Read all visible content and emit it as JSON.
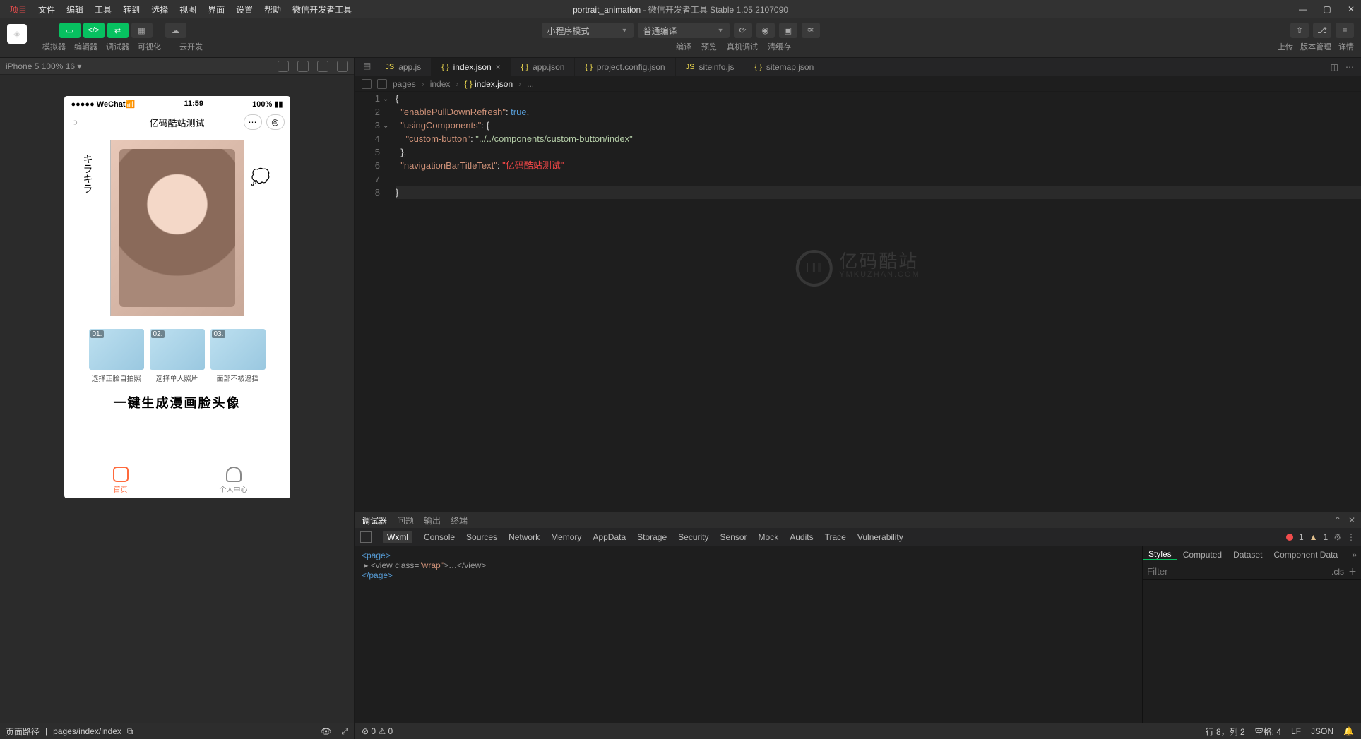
{
  "title": {
    "project": "portrait_animation",
    "sep": " - ",
    "app": "微信开发者工具 Stable 1.05.2107090"
  },
  "menu": [
    "项目",
    "文件",
    "编辑",
    "工具",
    "转到",
    "选择",
    "视图",
    "界面",
    "设置",
    "帮助",
    "微信开发者工具"
  ],
  "toolbar": {
    "left_labels": [
      "模拟器",
      "编辑器",
      "调试器",
      "可视化",
      "",
      "云开发"
    ],
    "mode_dd": "小程序模式",
    "compile_dd": "普通编译",
    "compile_labels": [
      "编译",
      "预览",
      "真机调试",
      "清缓存"
    ],
    "right_labels": [
      "上传",
      "版本管理",
      "详情"
    ]
  },
  "sim": {
    "device": "iPhone 5 100% 16",
    "status_left": "●●●●● WeChat",
    "status_wifi": "📶",
    "status_time": "11:59",
    "status_batt": "100%",
    "nav_title": "亿码酷站测试",
    "thumbs": [
      {
        "num": "01.",
        "cap": "选择正脸自拍照"
      },
      {
        "num": "02.",
        "cap": "选择单人照片"
      },
      {
        "num": "03.",
        "cap": "面部不被遮挡"
      }
    ],
    "slogan": "一键生成漫画脸头像",
    "tabs": [
      {
        "label": "首页",
        "active": true
      },
      {
        "label": "个人中心",
        "active": false
      }
    ]
  },
  "filetabs": [
    {
      "icon": "js",
      "name": "app.js"
    },
    {
      "icon": "json",
      "name": "index.json",
      "active": true
    },
    {
      "icon": "json",
      "name": "app.json"
    },
    {
      "icon": "json",
      "name": "project.config.json"
    },
    {
      "icon": "js",
      "name": "siteinfo.js"
    },
    {
      "icon": "json",
      "name": "sitemap.json"
    }
  ],
  "crumbs": [
    "pages",
    "index",
    "index.json",
    "..."
  ],
  "code": {
    "lines": [
      "1",
      "2",
      "3",
      "4",
      "5",
      "6",
      "7",
      "8"
    ],
    "l1": "{",
    "l2": {
      "k": "\"enablePullDownRefresh\"",
      "c": ": ",
      "v": "true",
      "e": ","
    },
    "l3": {
      "k": "\"usingComponents\"",
      "c": ": {"
    },
    "l4": {
      "k": "\"custom-button\"",
      "c": ": ",
      "v": "\"../../components/custom-button/index\""
    },
    "l5": "},",
    "l6": {
      "k": "\"navigationBarTitleText\"",
      "c": ": ",
      "v": "\"亿码酷站测试\""
    },
    "l8": "}"
  },
  "watermark": {
    "big": "亿码酷站",
    "small": "YMKUZHAN.COM"
  },
  "dbg": {
    "tabs1": [
      "调试器",
      "问题",
      "输出",
      "终端"
    ],
    "tabs2": [
      "Wxml",
      "Console",
      "Sources",
      "Network",
      "Memory",
      "AppData",
      "Storage",
      "Security",
      "Sensor",
      "Mock",
      "Audits",
      "Trace",
      "Vulnerability"
    ],
    "err_count": "1",
    "warn_count": "1",
    "wxml_l1": "<page>",
    "wxml_l2a": "▸ <view ",
    "wxml_l2b": "class=",
    "wxml_l2c": "\"wrap\"",
    "wxml_l2d": ">…</view>",
    "wxml_l3": "</page>",
    "styletabs": [
      "Styles",
      "Computed",
      "Dataset",
      "Component Data"
    ],
    "filter_ph": "Filter",
    "cls": ".cls"
  },
  "status": {
    "sim_left": "页面路径",
    "sim_path": "pages/index/index",
    "ed_err": "0",
    "ed_warn": "0",
    "line": "行 8，列 2",
    "spaces": "空格: 4",
    "eol": "LF",
    "lang": "JSON"
  }
}
